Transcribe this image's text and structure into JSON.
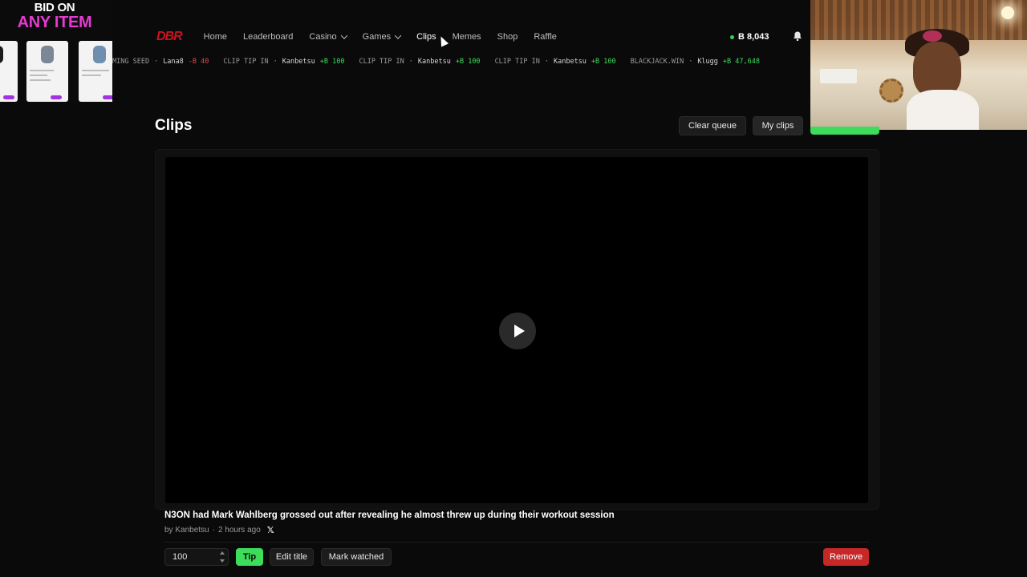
{
  "promo": {
    "line1": "BID ON",
    "line2": "ANY ITEM"
  },
  "nav": {
    "logo": "DBR",
    "items": [
      {
        "label": "Home"
      },
      {
        "label": "Leaderboard"
      },
      {
        "label": "Casino"
      },
      {
        "label": "Games"
      },
      {
        "label": "Clips"
      },
      {
        "label": "Memes"
      },
      {
        "label": "Shop"
      },
      {
        "label": "Raffle"
      }
    ],
    "balance": "B 8,043"
  },
  "ticker": [
    {
      "event": "MING SEED",
      "user": "Lana8",
      "amount": "-B 40"
    },
    {
      "event": "CLIP TIP IN",
      "user": "Kanbetsu",
      "amount": "+B 100"
    },
    {
      "event": "CLIP TIP IN",
      "user": "Kanbetsu",
      "amount": "+B 100"
    },
    {
      "event": "CLIP TIP IN",
      "user": "Kanbetsu",
      "amount": "+B 100"
    },
    {
      "event": "BLACKJACK.WIN",
      "user": "Klugg",
      "amount": "+B 47,648"
    }
  ],
  "page": {
    "title": "Clips",
    "clear_queue": "Clear queue",
    "my_clips": "My clips"
  },
  "clip": {
    "title": "N3ON had Mark Wahlberg grossed out after revealing he almost threw up during their workout session",
    "by": "by Kanbetsu",
    "separator": "·",
    "time": "2 hours ago",
    "x_glyph": "𝕏"
  },
  "controls": {
    "amount": "100",
    "tip": "Tip",
    "edit_title": "Edit title",
    "mark_watched": "Mark watched",
    "remove": "Remove"
  },
  "colors": {
    "accent_green": "#3ddc5b",
    "danger_red": "#c62828",
    "logo_red": "#c8141e",
    "promo_pink": "#e63ad1"
  }
}
